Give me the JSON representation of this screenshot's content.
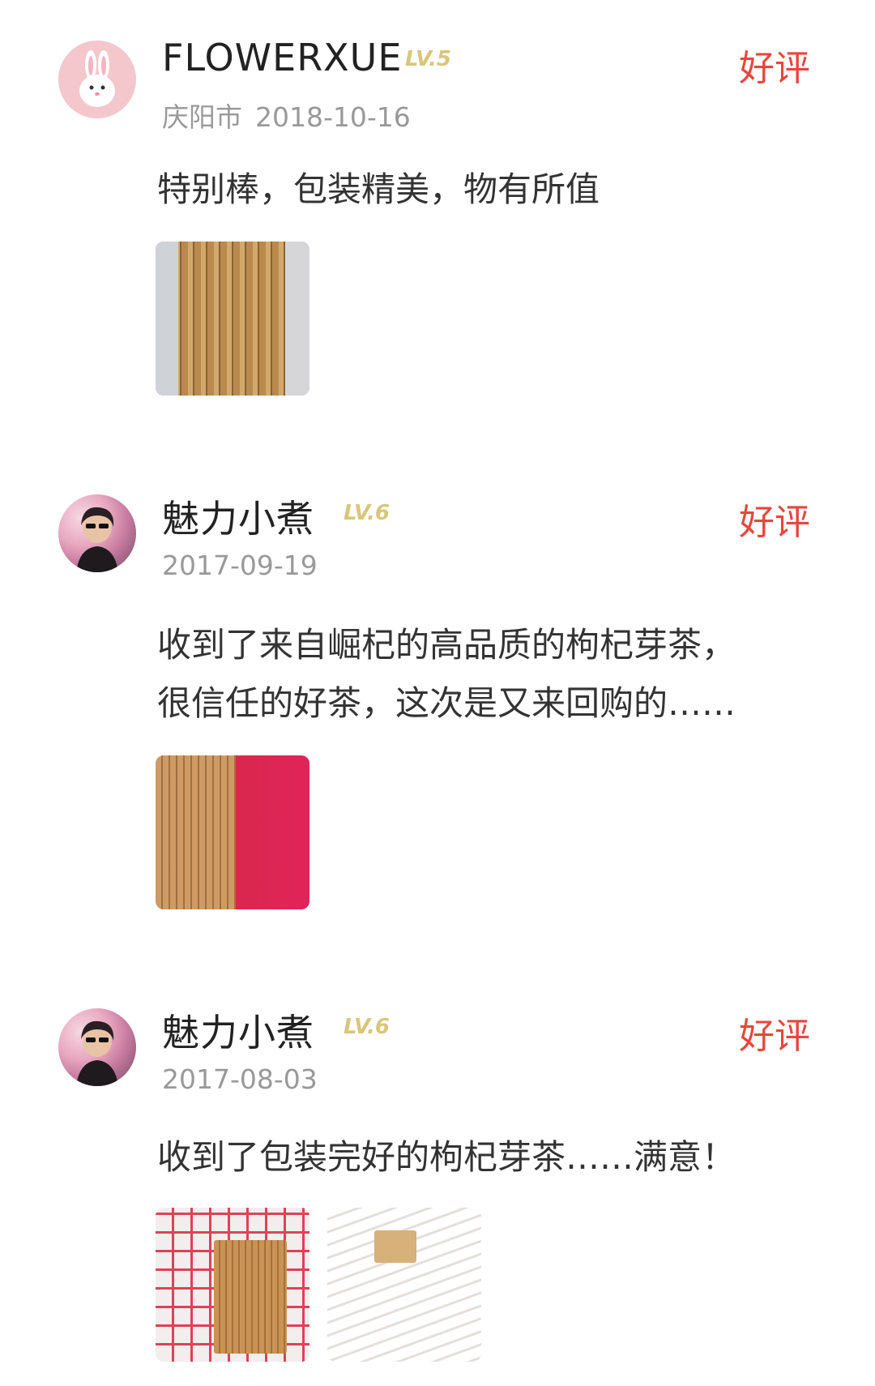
{
  "reviews": [
    {
      "user": "FLOWERXUE",
      "level": "LV.5",
      "location": "庆阳市",
      "date": "2018-10-16",
      "rating": "好评",
      "comment_lines": [
        "特别棒，包装精美，物有所值"
      ],
      "photo_count": 1
    },
    {
      "user": "魅力小煮",
      "level": "LV.6",
      "location": "",
      "date": "2017-09-19",
      "rating": "好评",
      "comment_lines": [
        "收到了来自崛杞的高品质的枸杞芽茶，",
        "很信任的好茶，这次是又来回购的……"
      ],
      "photo_count": 1
    },
    {
      "user": "魅力小煮",
      "level": "LV.6",
      "location": "",
      "date": "2017-08-03",
      "rating": "好评",
      "comment_lines": [
        "收到了包装完好的枸杞芽茶……满意！"
      ],
      "photo_count": 2
    }
  ],
  "colors": {
    "rating": "#e8463d",
    "level_badge": "#d9c67a",
    "meta": "#999999",
    "name": "#222222"
  },
  "icons": {
    "avatar_1": "rabbit-avatar-icon",
    "avatar_2": "user-photo-avatar",
    "avatar_3": "user-photo-avatar"
  }
}
